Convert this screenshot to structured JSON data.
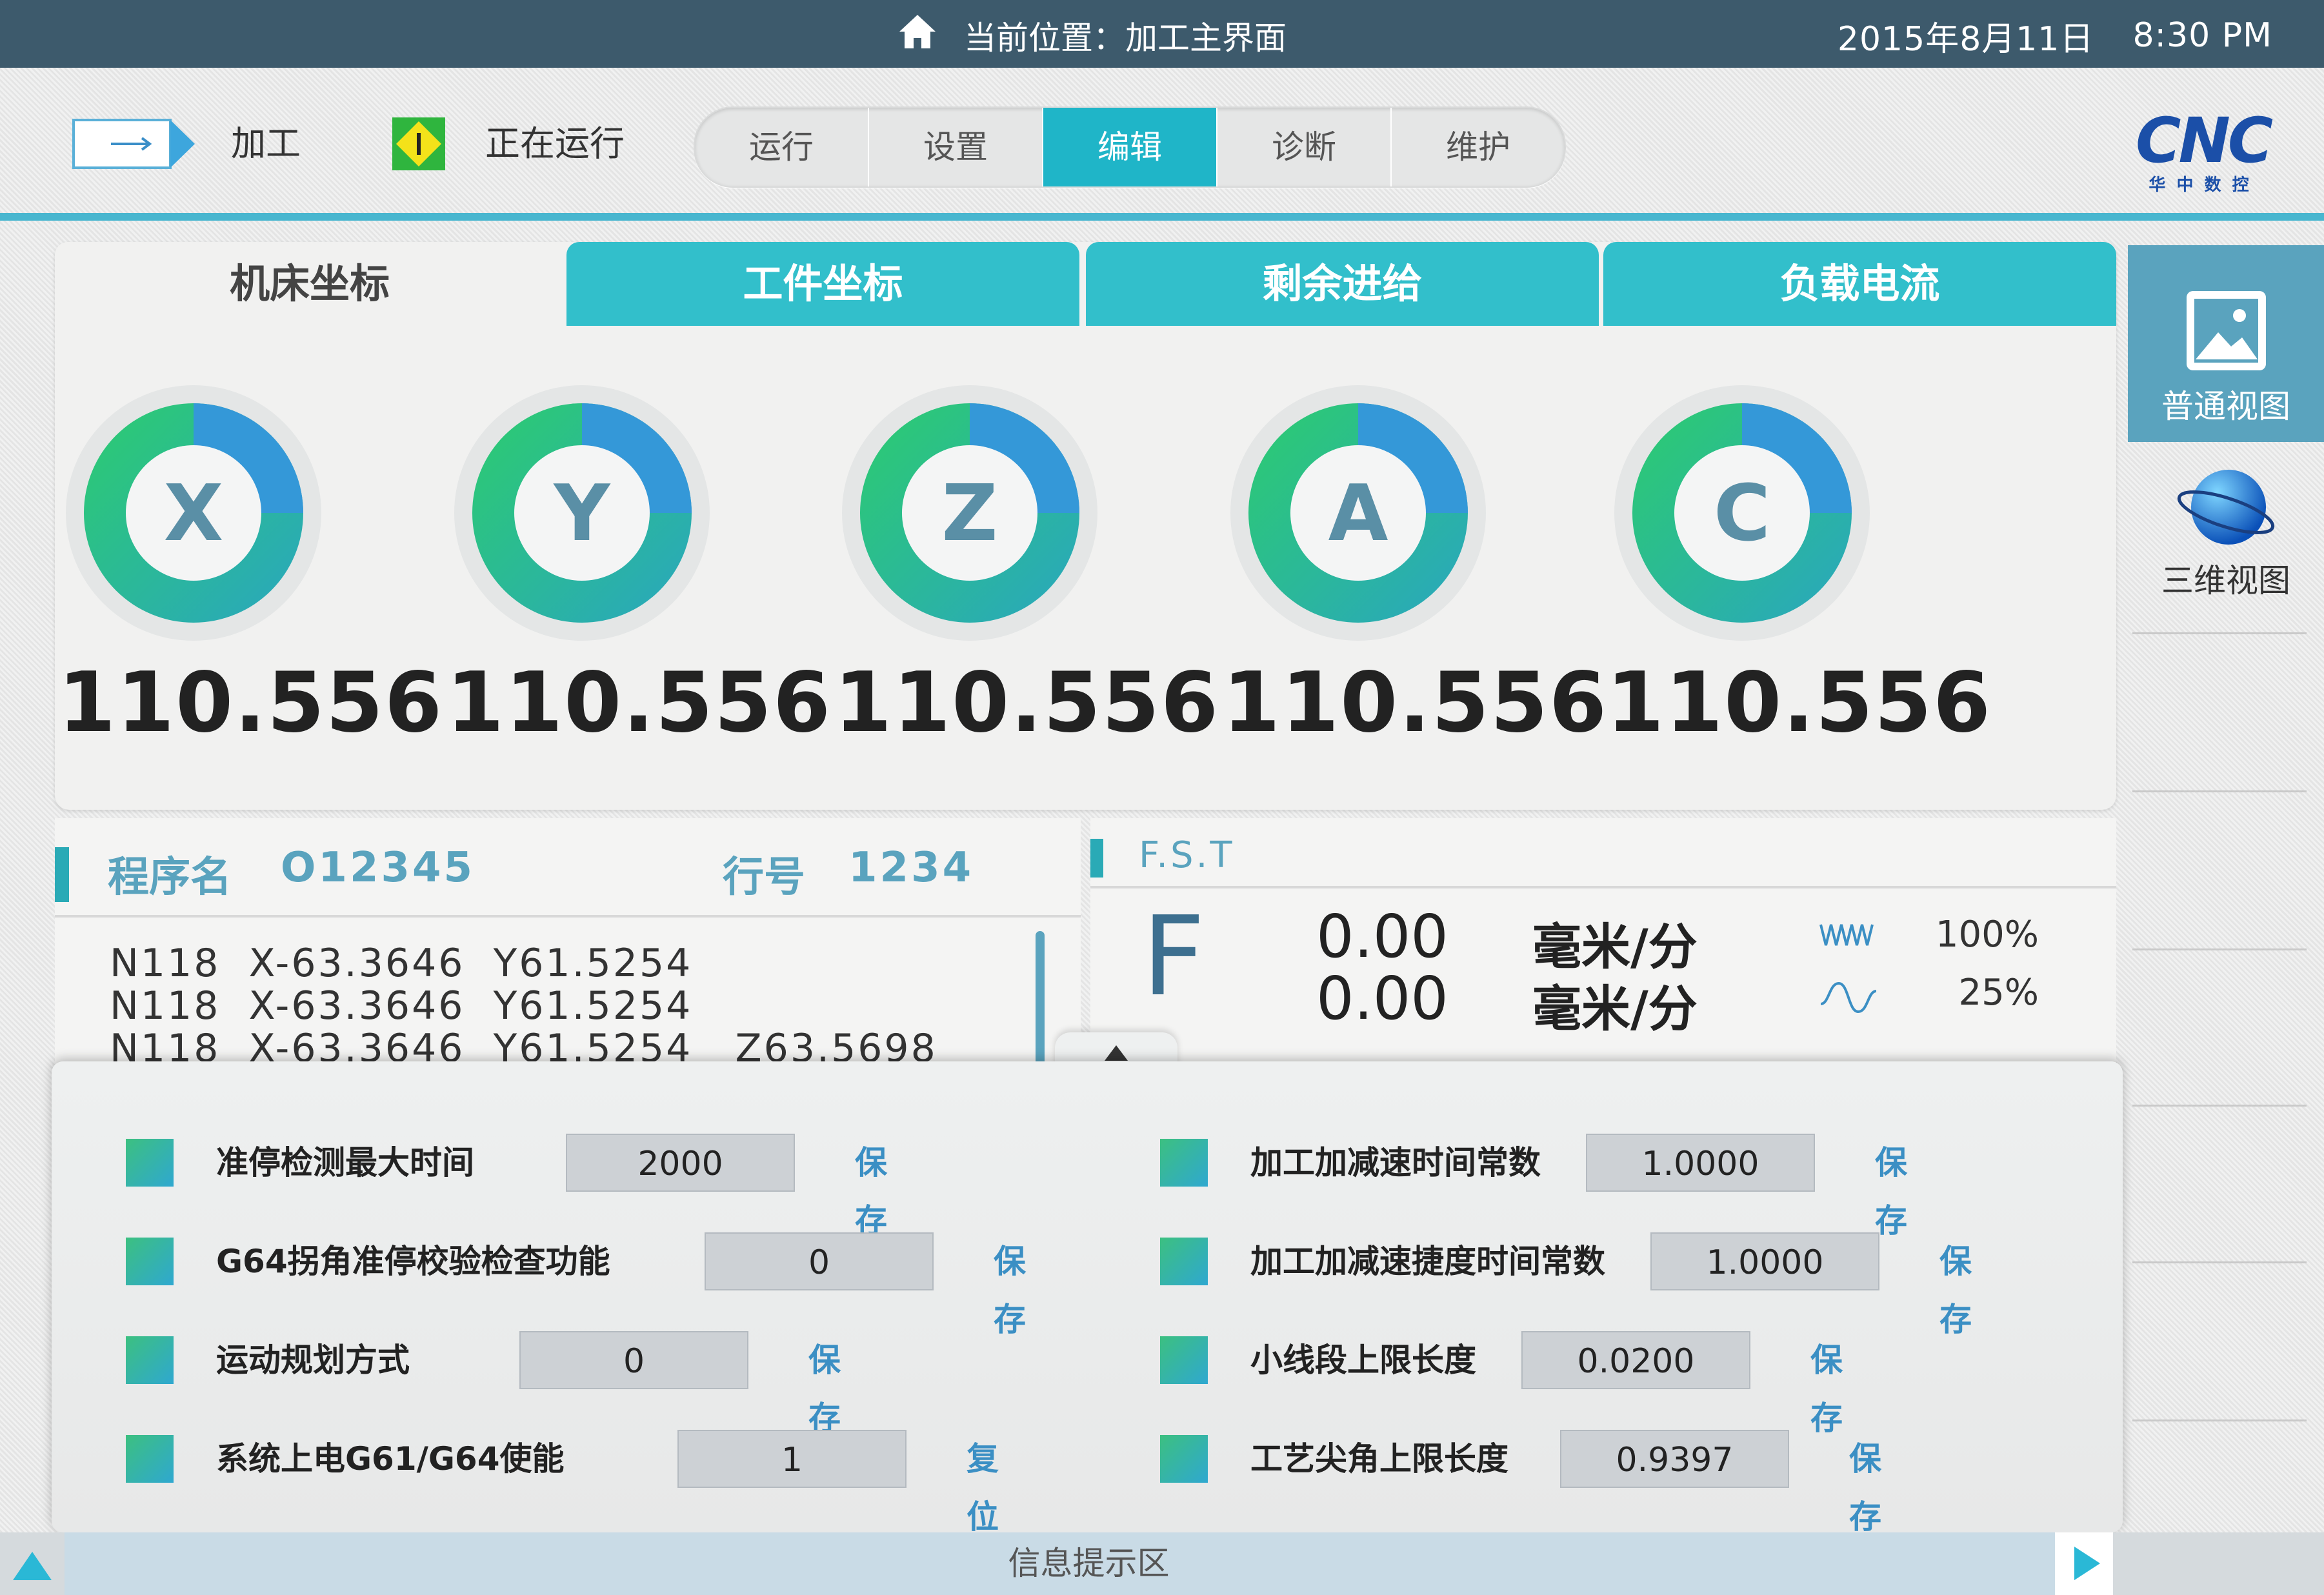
{
  "topbar": {
    "location": "当前位置：加工主界面",
    "date": "2015年8月11日",
    "time": "8:30 PM",
    "home_icon": "home-icon"
  },
  "header": {
    "mode_label": "加工",
    "status_label": "正在运行",
    "tabs": [
      "运行",
      "设置",
      "编辑",
      "诊断",
      "维护"
    ],
    "active_tab": "编辑",
    "logo": {
      "text": "CNC",
      "subtitle": "华 中 数 控"
    }
  },
  "coord_tabs": [
    "机床坐标",
    "工件坐标",
    "剩余进给",
    "负载电流"
  ],
  "axes": [
    {
      "name": "X",
      "value": "110.556"
    },
    {
      "name": "Y",
      "value": "110.556"
    },
    {
      "name": "Z",
      "value": "110.556"
    },
    {
      "name": "A",
      "value": "110.556"
    },
    {
      "name": "C",
      "value": "110.556"
    }
  ],
  "side": {
    "normal_view": "普通视图",
    "view3d": "三维视图"
  },
  "program": {
    "name_label": "程序名",
    "name": "O12345",
    "line_label": "行号",
    "line": "1234",
    "lines": [
      "N118  X-63.3646  Y61.5254",
      "N118  X-63.3646  Y61.5254",
      "N118  X-63.3646  Y61.5254   Z63.5698"
    ]
  },
  "fst": {
    "title": "F.S.T",
    "letter": "F",
    "rows": [
      {
        "value": "0.00",
        "unit": "毫米/分",
        "pct": "100%"
      },
      {
        "value": "0.00",
        "unit": "毫米/分",
        "pct": "25%"
      }
    ]
  },
  "params_left": [
    {
      "label": "准停检测最大时间",
      "value": "2000",
      "btn": "保存"
    },
    {
      "label": "G64拐角准停校验检查功能",
      "value": "0",
      "btn": "保存"
    },
    {
      "label": "运动规划方式",
      "value": "0",
      "btn": "保存"
    },
    {
      "label": "系统上电G61/G64使能",
      "value": "1",
      "btn": "复位"
    }
  ],
  "params_right": [
    {
      "label": "加工加减速时间常数",
      "value": "1.0000",
      "btn": "保存"
    },
    {
      "label": "加工加减速捷度时间常数",
      "value": "1.0000",
      "btn": "保存"
    },
    {
      "label": "小线段上限长度",
      "value": "0.0200",
      "btn": "保存"
    },
    {
      "label": "工艺尖角上限长度",
      "value": "0.9397",
      "btn": "保存"
    }
  ],
  "info": {
    "label": "信息提示区"
  },
  "colors": {
    "accent": "#1fb5c8",
    "topbar": "#3d5a6c",
    "link": "#3b8fc4"
  }
}
